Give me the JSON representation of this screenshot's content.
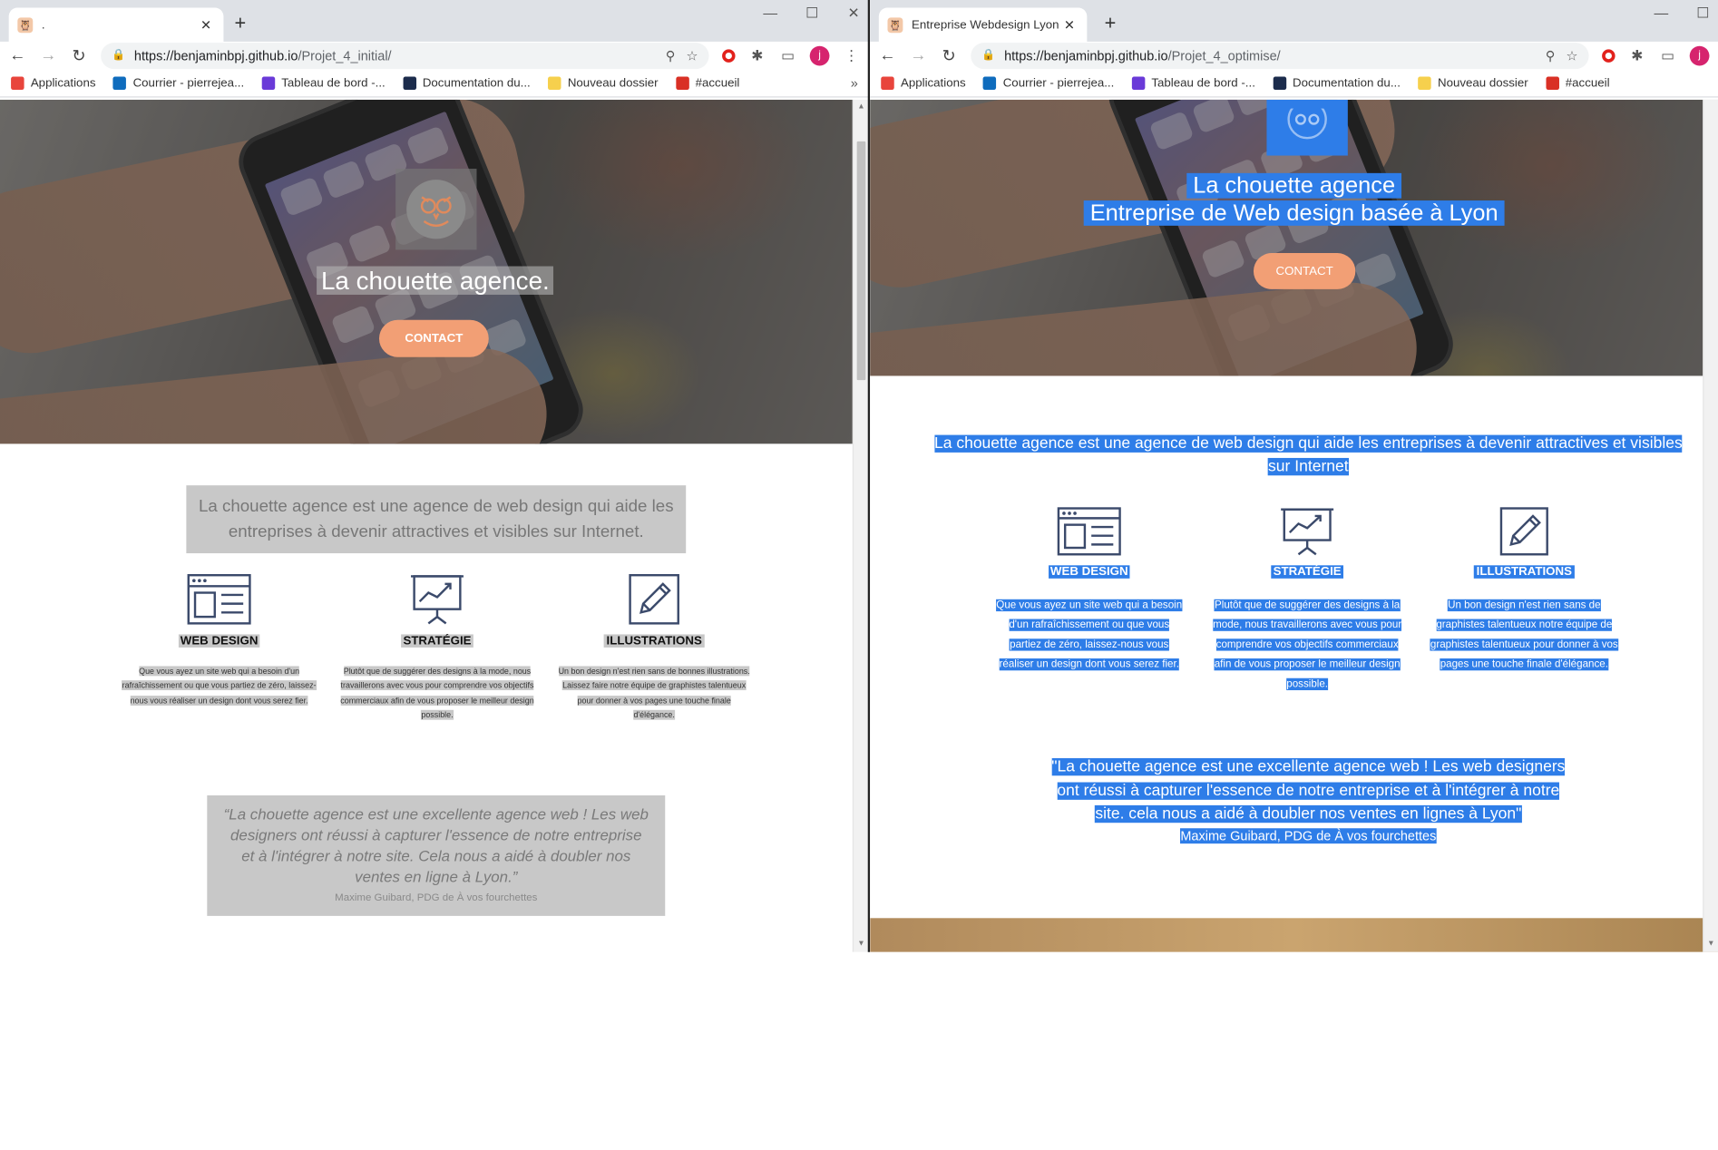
{
  "left": {
    "tab_title": ".",
    "url_host": "https://benjaminbpj.github.io",
    "url_path": "/Projet_4_initial/",
    "hero_title": "La chouette agence.",
    "contact": "CONTACT",
    "intro": "La chouette agence est une agence de web design qui aide les entreprises à devenir attractives et visibles sur Internet.",
    "services": [
      {
        "title": "WEB DESIGN",
        "desc": "Que vous ayez un site web qui a besoin d'un rafraîchissement ou que vous partiez de zéro, laissez-nous vous réaliser un design dont vous serez fier."
      },
      {
        "title": "STRATÉGIE",
        "desc": "Plutôt que de suggérer des designs à la mode, nous travaillerons avec vous pour comprendre vos objectifs commerciaux afin de vous proposer le meilleur design possible."
      },
      {
        "title": "ILLUSTRATIONS",
        "desc": "Un bon design n'est rien sans de bonnes illustrations. Laissez faire notre équipe de graphistes talentueux pour donner à vos pages une touche finale d'élégance."
      }
    ],
    "quote": "“La chouette agence est une excellente agence web ! Les web designers ont réussi à capturer l'essence de notre entreprise et à l'intégrer à notre site. Cela nous a aidé à doubler nos ventes en ligne à Lyon.”",
    "quote_author": "Maxime Guibard, PDG de À vos fourchettes"
  },
  "right": {
    "tab_title": "Entreprise Webdesign Lyon - La C",
    "url_host": "https://benjaminbpj.github.io",
    "url_path": "/Projet_4_optimise/",
    "hero_title_1": "La chouette agence",
    "hero_title_2": "Entreprise de Web design basée à Lyon",
    "contact": "CONTACT",
    "intro": "La chouette agence est une agence de web design qui aide les entreprises à devenir attractives et visibles sur Internet",
    "services": [
      {
        "title": "WEB DESIGN",
        "desc": "Que vous ayez un site web qui a besoin d'un rafraîchissement ou que vous partiez de zéro, laissez-nous vous réaliser un design dont vous serez fier."
      },
      {
        "title": "STRATÉGIE",
        "desc": "Plutôt que de suggérer des designs à la mode, nous travaillerons avec vous pour comprendre vos objectifs commerciaux afin de vous proposer le meilleur design possible."
      },
      {
        "title": "ILLUSTRATIONS",
        "desc": "Un bon design n'est rien sans de graphistes talentueux notre équipe de graphistes talentueux pour donner à vos pages une touche finale d'élégance."
      }
    ],
    "quote": "\"La chouette agence est une excellente agence web ! Les web designers ont réussi à capturer l'essence de notre entreprise et à l'intégrer à notre site. cela nous a aidé à doubler nos ventes en lignes à Lyon\"",
    "quote_author": "Maxime Guibard, PDG de À vos fourchettes"
  },
  "bookmarks": [
    {
      "label": "Applications",
      "icon": "apps-grid-icon",
      "color": "#e8453c"
    },
    {
      "label": "Courrier - pierrejea...",
      "icon": "outlook-icon",
      "color": "#0f6cbd"
    },
    {
      "label": "Tableau de bord -...",
      "icon": "dashboard-icon",
      "color": "#6a3ad8"
    },
    {
      "label": "Documentation du...",
      "icon": "docs-icon",
      "color": "#1c2c4c"
    },
    {
      "label": "Nouveau dossier",
      "icon": "folder-icon",
      "color": "#f6d04d"
    },
    {
      "label": "#accueil",
      "icon": "slack-icon",
      "color": "#d93025"
    }
  ],
  "bookmarks_more": "»",
  "accent_color": "#2e7de8",
  "button_color": "#f29f75"
}
